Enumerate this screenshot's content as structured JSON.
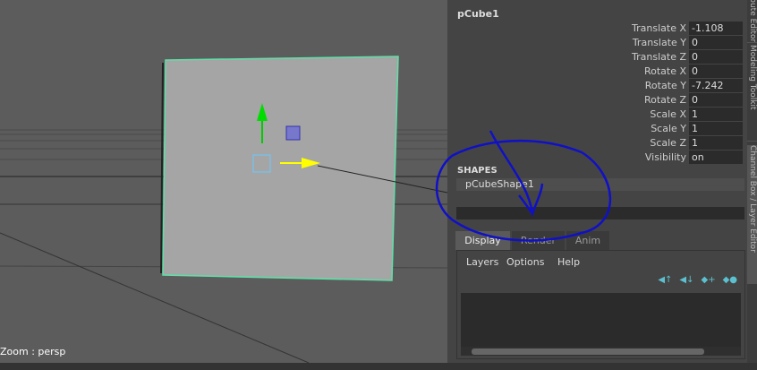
{
  "viewport": {
    "camera_label": "Zoom : persp"
  },
  "channel_box": {
    "object_name": "pCube1",
    "attributes": [
      {
        "label": "Translate X",
        "value": "-1.108"
      },
      {
        "label": "Translate Y",
        "value": "0"
      },
      {
        "label": "Translate Z",
        "value": "0"
      },
      {
        "label": "Rotate X",
        "value": "0"
      },
      {
        "label": "Rotate Y",
        "value": "-7.242"
      },
      {
        "label": "Rotate Z",
        "value": "0"
      },
      {
        "label": "Scale X",
        "value": "1"
      },
      {
        "label": "Scale Y",
        "value": "1"
      },
      {
        "label": "Scale Z",
        "value": "1"
      },
      {
        "label": "Visibility",
        "value": "on"
      }
    ],
    "shapes_header": "SHAPES",
    "shape_name": "pCubeShape1"
  },
  "layer_editor": {
    "tabs": [
      "Display",
      "Render",
      "Anim"
    ],
    "menu": [
      "Layers",
      "Options",
      "Help"
    ]
  },
  "side_tabs": [
    "Attribute Editor",
    "Modeling Toolkit",
    "Channel Box / Layer Editor"
  ],
  "colors": {
    "annotation": "#1010c8",
    "selection": "#4fe0a0"
  }
}
